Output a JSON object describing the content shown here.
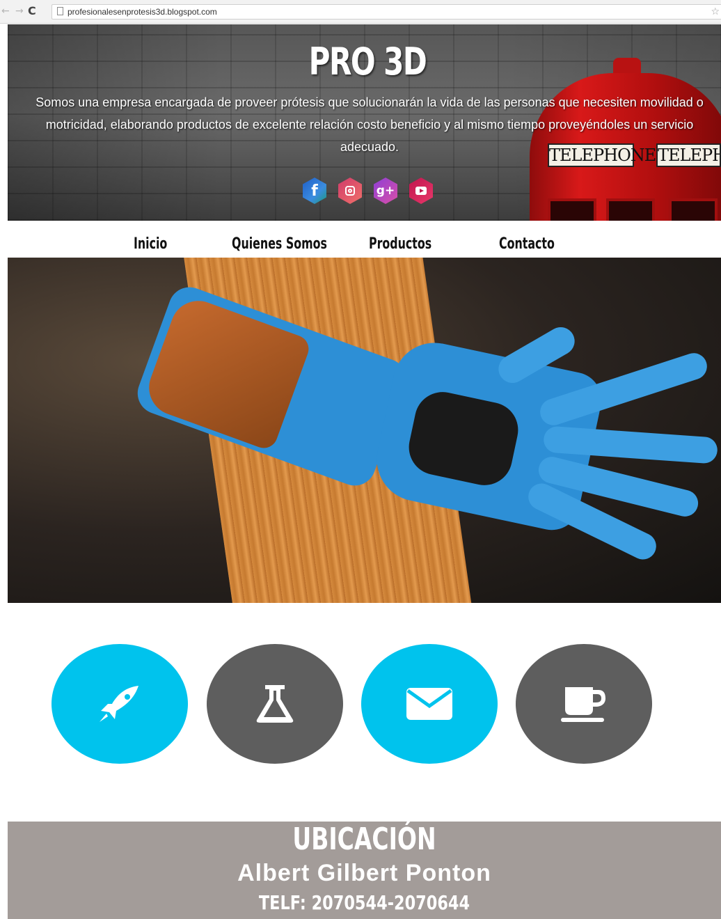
{
  "browser": {
    "url": "profesionalesenprotesis3d.blogspot.com"
  },
  "header": {
    "title": "PRO 3D",
    "description": "Somos una empresa encargada de proveer prótesis que solucionarán la vida de las personas que necesiten movilidad o motricidad, elaborando productos de excelente relación costo beneficio y al mismo tiempo proveyéndoles un servicio adecuado.",
    "phonebox_sign_1": "TELEPHONE",
    "phonebox_sign_2": "TELEPHONE",
    "social": [
      {
        "icon": "facebook-icon",
        "glyph": "f",
        "color": "#1f5fc8"
      },
      {
        "icon": "instagram-icon",
        "color": "#d03b6a"
      },
      {
        "icon": "google-plus-icon",
        "glyph": "g+",
        "color": "#8e3fd6"
      },
      {
        "icon": "youtube-icon",
        "color": "#c0154e"
      }
    ]
  },
  "nav": {
    "items": [
      {
        "label": "Inicio"
      },
      {
        "label": "Quienes Somos"
      },
      {
        "label": "Productos"
      },
      {
        "label": "Contacto"
      }
    ]
  },
  "features": [
    {
      "icon": "rocket-icon",
      "color": "#00c3ed"
    },
    {
      "icon": "flask-icon",
      "color": "#5e5e5e"
    },
    {
      "icon": "envelope-icon",
      "color": "#00c3ed"
    },
    {
      "icon": "coffee-cup-icon",
      "color": "#5e5e5e"
    }
  ],
  "footer": {
    "title": "UBICACIÓN",
    "name": "Albert Gilbert Ponton",
    "phone": "TELF:  2070544-2070644",
    "background": "#a39c99"
  }
}
